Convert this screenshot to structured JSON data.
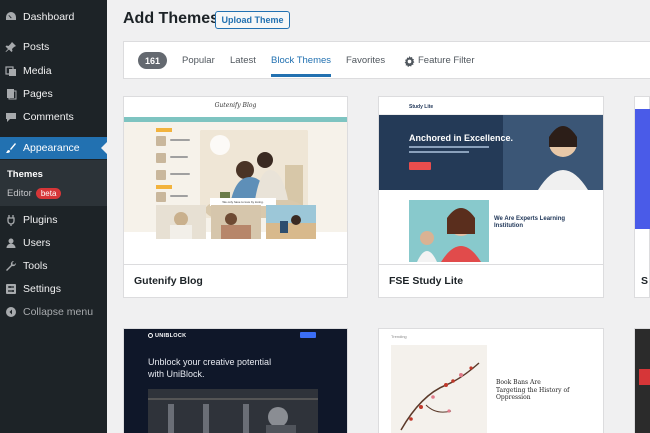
{
  "sidebar": {
    "items": [
      {
        "label": "Dashboard",
        "icon": "dashboard-icon"
      },
      {
        "label": "Posts",
        "icon": "pin-icon"
      },
      {
        "label": "Media",
        "icon": "media-icon"
      },
      {
        "label": "Pages",
        "icon": "pages-icon"
      },
      {
        "label": "Comments",
        "icon": "comment-icon"
      },
      {
        "label": "Appearance",
        "icon": "brush-icon"
      },
      {
        "label": "Plugins",
        "icon": "plug-icon"
      },
      {
        "label": "Users",
        "icon": "user-icon"
      },
      {
        "label": "Tools",
        "icon": "wrench-icon"
      },
      {
        "label": "Settings",
        "icon": "settings-icon"
      },
      {
        "label": "Collapse menu",
        "icon": "collapse-icon"
      }
    ],
    "submenu": {
      "themes": "Themes",
      "editor": "Editor",
      "editor_badge": "beta"
    }
  },
  "header": {
    "title": "Add Themes",
    "upload_label": "Upload Theme"
  },
  "filter": {
    "count": "161",
    "tabs": [
      "Popular",
      "Latest",
      "Block Themes",
      "Favorites"
    ],
    "active_tab": "Block Themes",
    "feature_filter": "Feature Filter"
  },
  "themes": [
    {
      "name": "Gutenify Blog",
      "preview": {
        "logo": "Gutenify Blog",
        "caption": "We only have to love by loving."
      }
    },
    {
      "name": "FSE Study Lite",
      "preview": {
        "brand": "Study Lite",
        "hero_title": "Anchored in Excellence.",
        "headline": "We Are Experts Learning Institution"
      }
    },
    {
      "preview": {
        "logo": "UNIBLOCK",
        "title": "Unblock your creative potential with UniBlock."
      }
    },
    {
      "preview": {
        "tag": "Trending",
        "title": "Book Bans Are Targeting the History of Oppression"
      }
    }
  ],
  "colors": {
    "sidebar_bg": "#1d2327",
    "accent": "#2271b1",
    "badge_red": "#d63638"
  }
}
